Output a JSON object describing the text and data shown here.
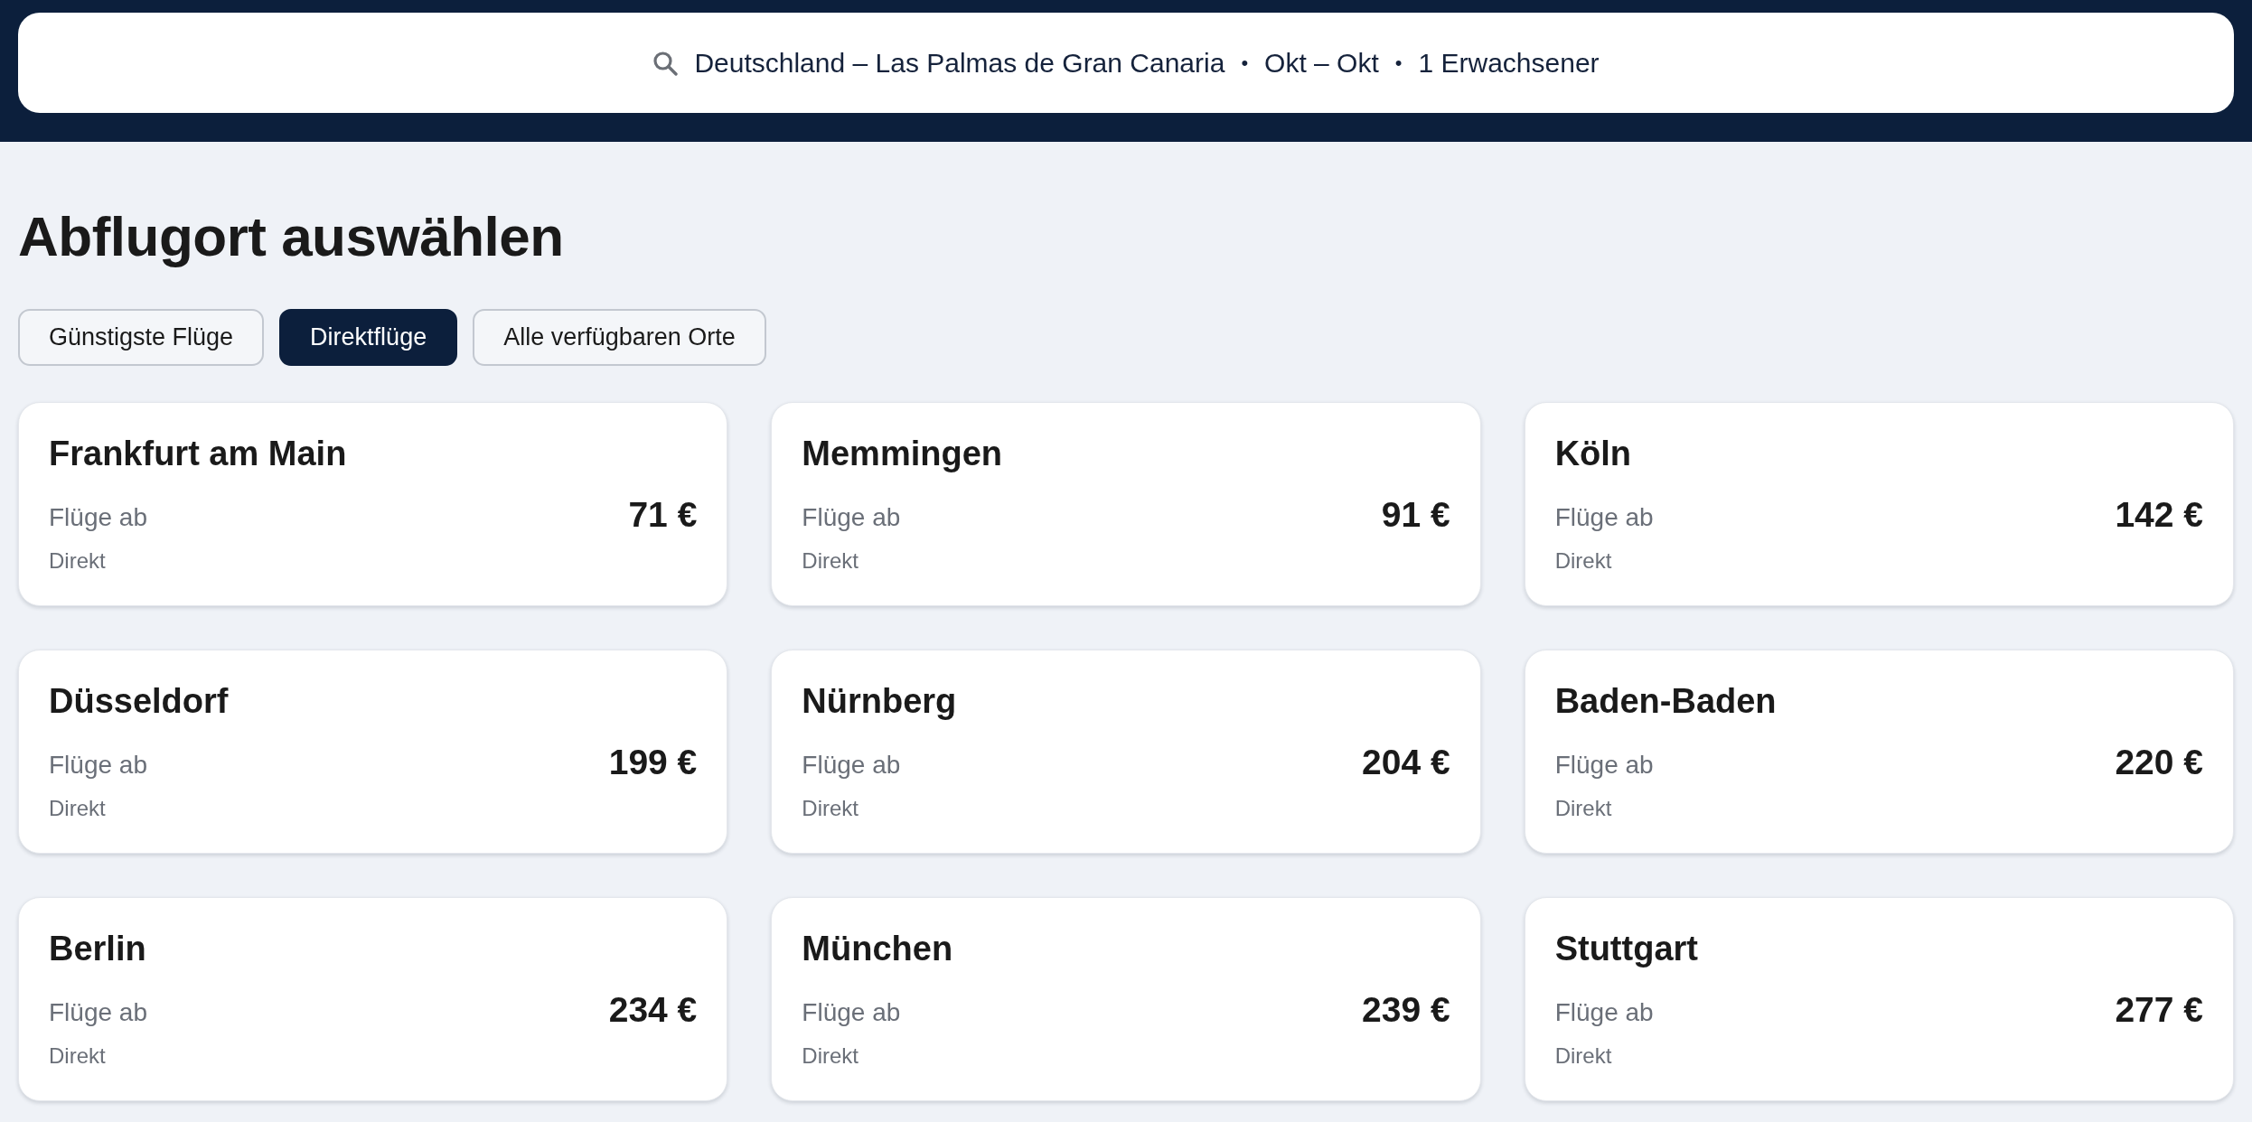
{
  "search_bar": {
    "segments": [
      "Deutschland – Las Palmas de Gran Canaria",
      "Okt – Okt",
      "1 Erwachsener"
    ],
    "separators": [
      "•",
      "•"
    ]
  },
  "title": "Abflugort auswählen",
  "filters": [
    {
      "label": "Günstigste Flüge",
      "selected": false
    },
    {
      "label": "Direktflüge",
      "selected": true
    },
    {
      "label": "Alle verfügbaren Orte",
      "selected": false
    }
  ],
  "destinations": [
    {
      "city": "Frankfurt am Main",
      "price_label": "Flüge ab",
      "price": "71 €",
      "stops": "Direkt"
    },
    {
      "city": "Memmingen",
      "price_label": "Flüge ab",
      "price": "91 €",
      "stops": "Direkt"
    },
    {
      "city": "Köln",
      "price_label": "Flüge ab",
      "price": "142 €",
      "stops": "Direkt"
    },
    {
      "city": "Düsseldorf",
      "price_label": "Flüge ab",
      "price": "199 €",
      "stops": "Direkt"
    },
    {
      "city": "Nürnberg",
      "price_label": "Flüge ab",
      "price": "204 €",
      "stops": "Direkt"
    },
    {
      "city": "Baden-Baden",
      "price_label": "Flüge ab",
      "price": "220 €",
      "stops": "Direkt"
    },
    {
      "city": "Berlin",
      "price_label": "Flüge ab",
      "price": "234 €",
      "stops": "Direkt"
    },
    {
      "city": "München",
      "price_label": "Flüge ab",
      "price": "239 €",
      "stops": "Direkt"
    },
    {
      "city": "Stuttgart",
      "price_label": "Flüge ab",
      "price": "277 €",
      "stops": "Direkt"
    }
  ]
}
